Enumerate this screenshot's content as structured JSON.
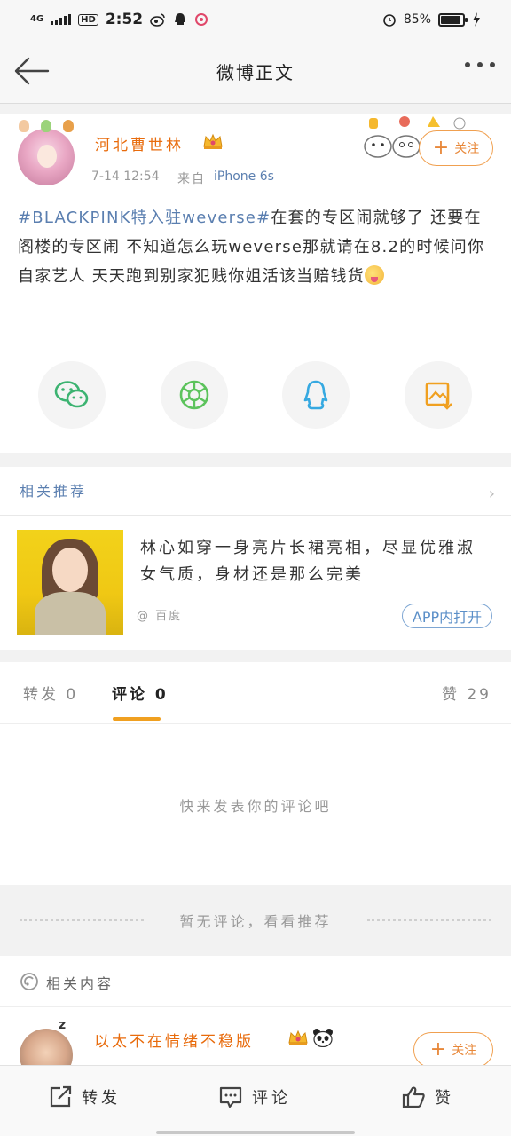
{
  "status_bar": {
    "network": "4G",
    "hd": "HD",
    "time": "2:52",
    "battery_percent": "85%",
    "battery_level": 0.85
  },
  "header": {
    "title": "微博正文"
  },
  "post": {
    "username": "河北曹世林",
    "time": "7-14 12:54",
    "from_label": "来自",
    "device": "iPhone 6s",
    "follow_label": "关注",
    "topic": "#BLACKPINK特入驻weverse#",
    "body": "在套的专区闹就够了 还要在阁楼的专区闹 不知道怎么玩weverse那就请在8.2的时候问你自家艺人 天天跑到别家犯贱你姐活该当赔钱货",
    "share_icons": [
      "wechat-icon",
      "moments-icon",
      "qq-icon",
      "save-image-icon"
    ],
    "accent_color": "#e86b0c",
    "link_color": "#5b7fb0"
  },
  "recommendations": {
    "title": "相关推荐",
    "card": {
      "text": "林心如穿一身亮片长裙亮相，尽显优雅淑女气质，身材还是那么完美",
      "source": "@ 百度",
      "open_label": "APP内打开"
    }
  },
  "tabs": {
    "repost": "转发 0",
    "comment": "评论 0",
    "like": "赞 29"
  },
  "comments": {
    "empty_prompt": "快来发表你的评论吧",
    "no_comments": "暂无评论，看看推荐"
  },
  "related": {
    "title": "相关内容",
    "user": {
      "username": "以太不在情绪不稳版",
      "follow_label": "关注"
    }
  },
  "bottom_bar": {
    "repost": "转发",
    "comment": "评论",
    "like": "赞"
  }
}
